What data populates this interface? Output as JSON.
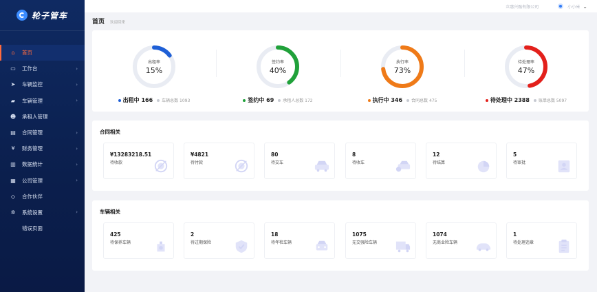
{
  "brand": {
    "name": "轮子管车"
  },
  "topbar": {
    "company": "众惠兴融有限公司",
    "username": "小小米"
  },
  "breadcrumb": {
    "title": "首页",
    "welcome": "欢迎回来"
  },
  "sidebar": {
    "items": [
      {
        "label": "首页",
        "icon": "home-icon",
        "glyph": "⌂",
        "arrow": false,
        "active": true
      },
      {
        "label": "工作台",
        "icon": "monitor-icon",
        "glyph": "▭",
        "arrow": true
      },
      {
        "label": "车辆监控",
        "icon": "send-icon",
        "glyph": "➤",
        "arrow": true
      },
      {
        "label": "车辆管理",
        "icon": "car-icon",
        "glyph": "▰",
        "arrow": true
      },
      {
        "label": "承租人管理",
        "icon": "users-icon",
        "glyph": "☻",
        "arrow": false
      },
      {
        "label": "合同管理",
        "icon": "book-icon",
        "glyph": "▤",
        "arrow": true
      },
      {
        "label": "财务管理",
        "icon": "yen-icon",
        "glyph": "¥",
        "arrow": true
      },
      {
        "label": "数据统计",
        "icon": "bar-chart-icon",
        "glyph": "▥",
        "arrow": true
      },
      {
        "label": "公司管理",
        "icon": "bank-icon",
        "glyph": "▦",
        "arrow": true
      },
      {
        "label": "合作伙伴",
        "icon": "handshake-icon",
        "glyph": "◇",
        "arrow": false
      },
      {
        "label": "系统设置",
        "icon": "gears-icon",
        "glyph": "✲",
        "arrow": true
      },
      {
        "label": "错误页面",
        "icon": "",
        "glyph": "",
        "arrow": false
      }
    ]
  },
  "stats": [
    {
      "ring_label": "出租率",
      "percent": 15,
      "color": "#1e5fd6",
      "main": "出租中 166",
      "sub": "车辆总数 1093"
    },
    {
      "ring_label": "签约率",
      "percent": 40,
      "color": "#20a13a",
      "main": "签约中 69",
      "sub": "承租人总数 172"
    },
    {
      "ring_label": "执行率",
      "percent": 73,
      "color": "#ef7a18",
      "main": "执行中 346",
      "sub": "合同总数 475"
    },
    {
      "ring_label": "待处理率",
      "percent": 47,
      "color": "#e3201b",
      "main": "待处理中 2388",
      "sub": "账单总数 5097"
    }
  ],
  "colors": {
    "ring_track": "#e9ecf3",
    "accent": "#ff6a3d",
    "sidebar": "#0f2a62"
  },
  "contract": {
    "title": "合同相关",
    "cards": [
      {
        "value": "¥13283218.51",
        "label": "待收款",
        "icon": "stamp-icon"
      },
      {
        "value": "¥4821",
        "label": "待付款",
        "icon": "stamp-icon"
      },
      {
        "value": "80",
        "label": "待交车",
        "icon": "car-icon"
      },
      {
        "value": "8",
        "label": "待收车",
        "icon": "car-coin-icon"
      },
      {
        "value": "12",
        "label": "待结算",
        "icon": "pie-icon"
      },
      {
        "value": "5",
        "label": "待审批",
        "icon": "person-card-icon"
      }
    ]
  },
  "vehicle": {
    "title": "车辆相关",
    "cards": [
      {
        "value": "425",
        "label": "待保养车辆",
        "icon": "oil-can-icon"
      },
      {
        "value": "2",
        "label": "待过期保险",
        "icon": "shield-icon"
      },
      {
        "value": "18",
        "label": "待年检车辆",
        "icon": "car-front-icon"
      },
      {
        "value": "1075",
        "label": "无交强险车辆",
        "icon": "truck-icon"
      },
      {
        "value": "1074",
        "label": "无商业险车辆",
        "icon": "sedan-icon"
      },
      {
        "value": "1",
        "label": "待处理违章",
        "icon": "clipboard-icon"
      }
    ]
  }
}
